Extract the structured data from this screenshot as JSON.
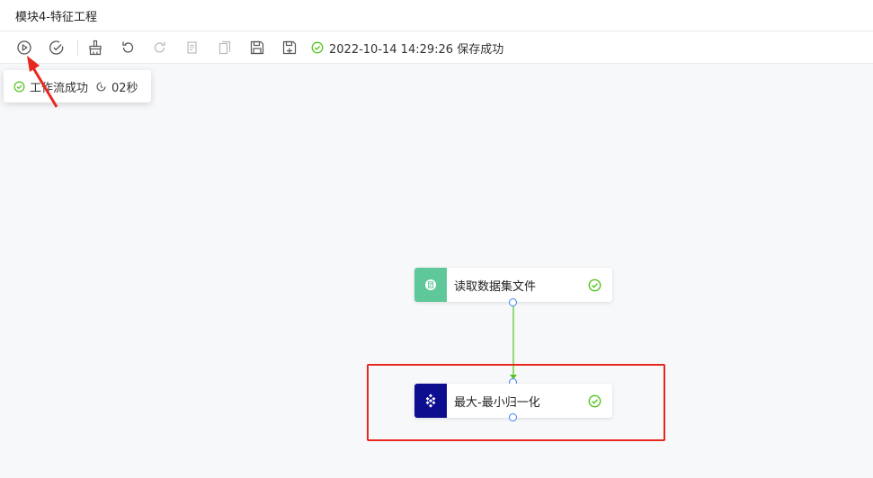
{
  "window": {
    "title": "模块4-特征工程"
  },
  "toolbar": {
    "buttons": [
      {
        "name": "run",
        "icon": "play-circle-icon"
      },
      {
        "name": "validate",
        "icon": "check-circle-icon"
      },
      {
        "name": "clear",
        "icon": "broom-icon"
      },
      {
        "name": "undo",
        "icon": "undo-icon"
      },
      {
        "name": "redo",
        "icon": "redo-icon"
      },
      {
        "name": "copy",
        "icon": "copy-icon"
      },
      {
        "name": "paste",
        "icon": "paste-icon"
      },
      {
        "name": "save",
        "icon": "save-icon"
      },
      {
        "name": "save-as",
        "icon": "save-as-icon"
      }
    ],
    "save_status": "2022-10-14 14:29:26 保存成功"
  },
  "run_result": {
    "text": "工作流成功",
    "duration": "02秒"
  },
  "nodes": [
    {
      "id": "read-dataset",
      "label": "读取数据集文件",
      "icon_color": "#5fc89a",
      "status": "success"
    },
    {
      "id": "minmax-normalize",
      "label": "最大-最小归一化",
      "icon_color": "#0d0d8f",
      "status": "success"
    }
  ],
  "colors": {
    "success": "#52c41a",
    "port": "#3b82f6",
    "edge": "#52c41a",
    "annotation": "#e8281f"
  }
}
